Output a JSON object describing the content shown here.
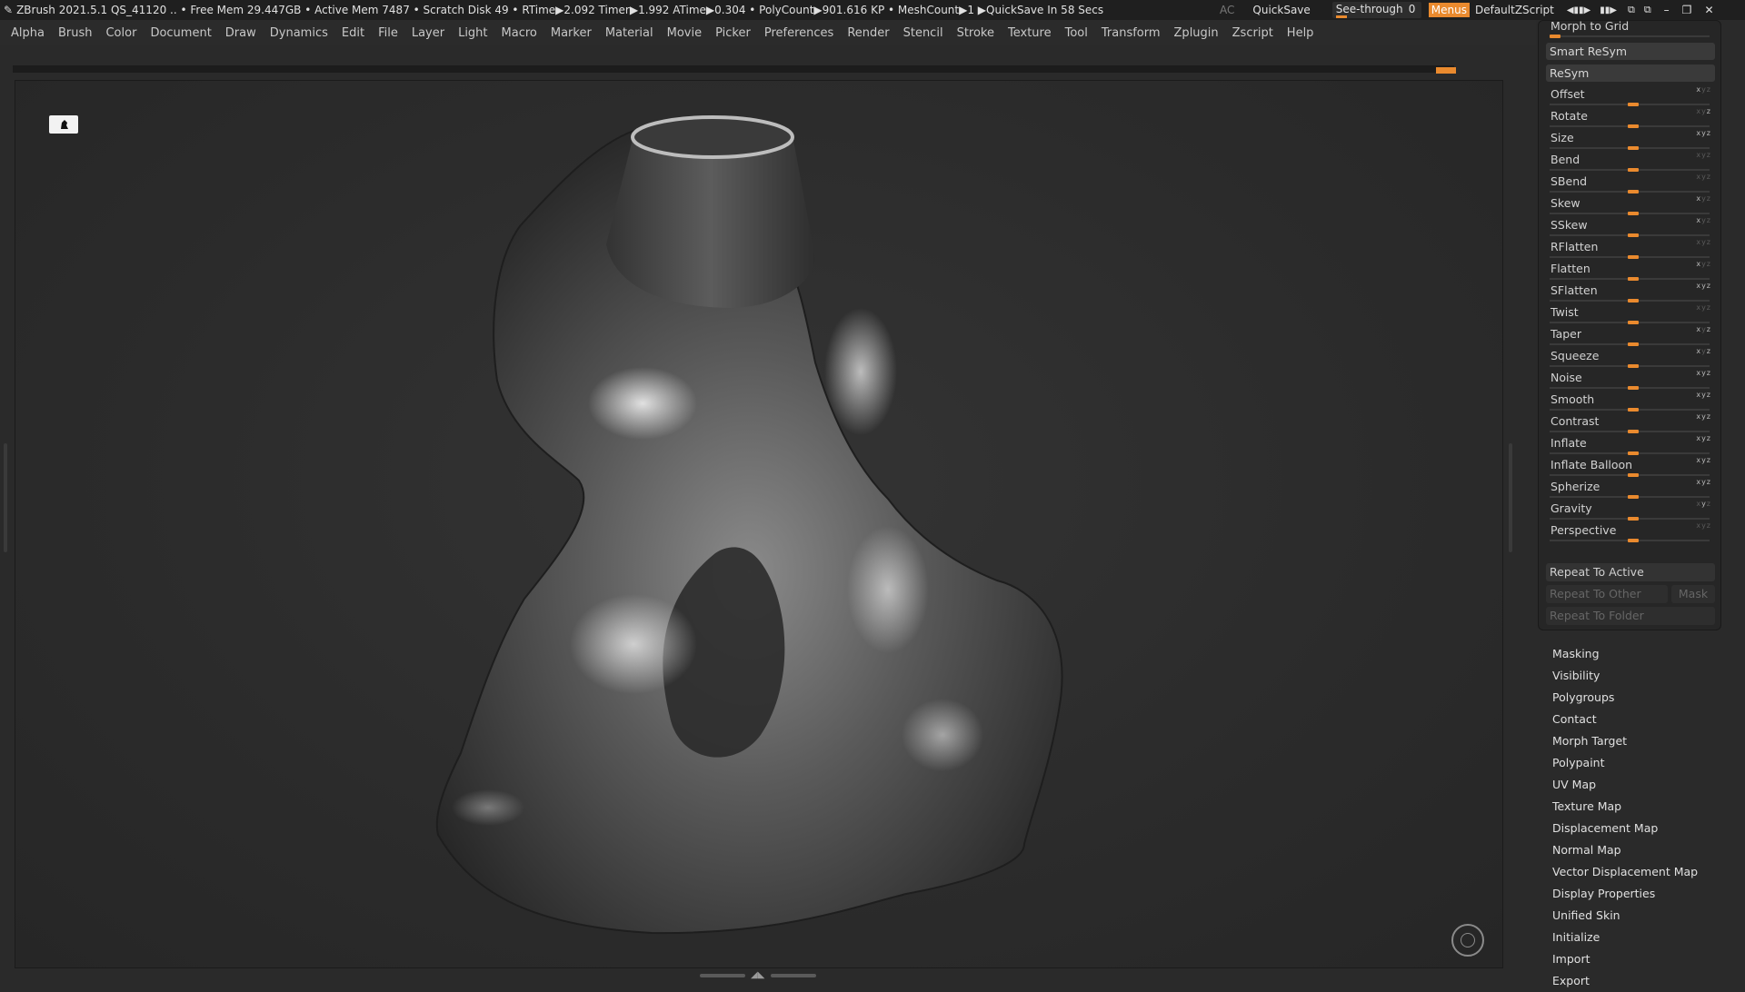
{
  "titlebar": {
    "status_text": "ZBrush 2021.5.1    QS_41120    .. • Free Mem 29.447GB • Active Mem 7487 • Scratch Disk 49 •  RTime▶2.092 Timer▶1.992 ATime▶0.304 • PolyCount▶901.616 KP  • MeshCount▶1   ▶QuickSave In 58 Secs",
    "ac_label": "AC",
    "quicksave_label": "QuickSave",
    "seethrough_label": "See-through",
    "seethrough_value": "0",
    "menus_label": "Menus",
    "zscript_label": "DefaultZScript"
  },
  "menubar": {
    "items": [
      "Alpha",
      "Brush",
      "Color",
      "Document",
      "Draw",
      "Dynamics",
      "Edit",
      "File",
      "Layer",
      "Light",
      "Macro",
      "Marker",
      "Material",
      "Movie",
      "Picker",
      "Preferences",
      "Render",
      "Stencil",
      "Stroke",
      "Texture",
      "Tool",
      "Transform",
      "Zplugin",
      "Zscript",
      "Help"
    ]
  },
  "panel": {
    "morph_label": "Morph to Grid",
    "smart_resym_label": "Smart ReSym",
    "resym_label": "ReSym",
    "sliders": [
      {
        "label": "Offset"
      },
      {
        "label": "Rotate"
      },
      {
        "label": "Size"
      },
      {
        "label": "Bend"
      },
      {
        "label": "SBend"
      },
      {
        "label": "Skew"
      },
      {
        "label": "SSkew"
      },
      {
        "label": "RFlatten"
      },
      {
        "label": "Flatten"
      },
      {
        "label": "SFlatten"
      },
      {
        "label": "Twist"
      },
      {
        "label": "Taper"
      },
      {
        "label": "Squeeze"
      },
      {
        "label": "Noise"
      },
      {
        "label": "Smooth"
      },
      {
        "label": "Contrast"
      },
      {
        "label": "Inflate"
      },
      {
        "label": "Inflate Balloon"
      },
      {
        "label": "Spherize"
      },
      {
        "label": "Gravity"
      },
      {
        "label": "Perspective"
      }
    ],
    "repeat_active": "Repeat To Active",
    "repeat_other": "Repeat To Other",
    "mask_label": "Mask",
    "repeat_folder": "Repeat To Folder"
  },
  "subpalettes": [
    "Masking",
    "Visibility",
    "Polygroups",
    "Contact",
    "Morph Target",
    "Polypaint",
    "UV Map",
    "Texture Map",
    "Displacement Map",
    "Normal Map",
    "Vector Displacement Map",
    "Display Properties",
    "Unified Skin",
    "Initialize",
    "Import",
    "Export"
  ],
  "colors": {
    "accent": "#ea8a2e",
    "background": "#2a2a2a",
    "panel": "#262626"
  }
}
